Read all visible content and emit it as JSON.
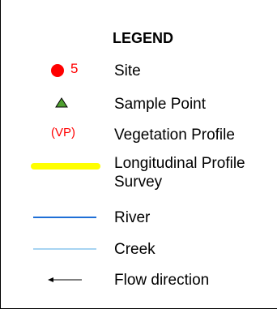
{
  "legend": {
    "title": "LEGEND",
    "items": [
      {
        "label": "Site",
        "symbol_text": "5",
        "color": "#ff0000",
        "icon": "red-circle"
      },
      {
        "label": "Sample Point",
        "color": "#4f9f2f",
        "icon": "green-triangle"
      },
      {
        "label": "Vegetation Profile",
        "symbol_text": "(VP)",
        "color": "#ff0000",
        "icon": "vp-text"
      },
      {
        "label": "Longitudinal Profile Survey",
        "color": "#ffff00",
        "icon": "yellow-line"
      },
      {
        "label": "River",
        "color": "#1f6fd6",
        "icon": "river-line"
      },
      {
        "label": "Creek",
        "color": "#4fa8e6",
        "icon": "creek-line"
      },
      {
        "label": "Flow direction",
        "color": "#000000",
        "icon": "arrow-left"
      }
    ]
  }
}
